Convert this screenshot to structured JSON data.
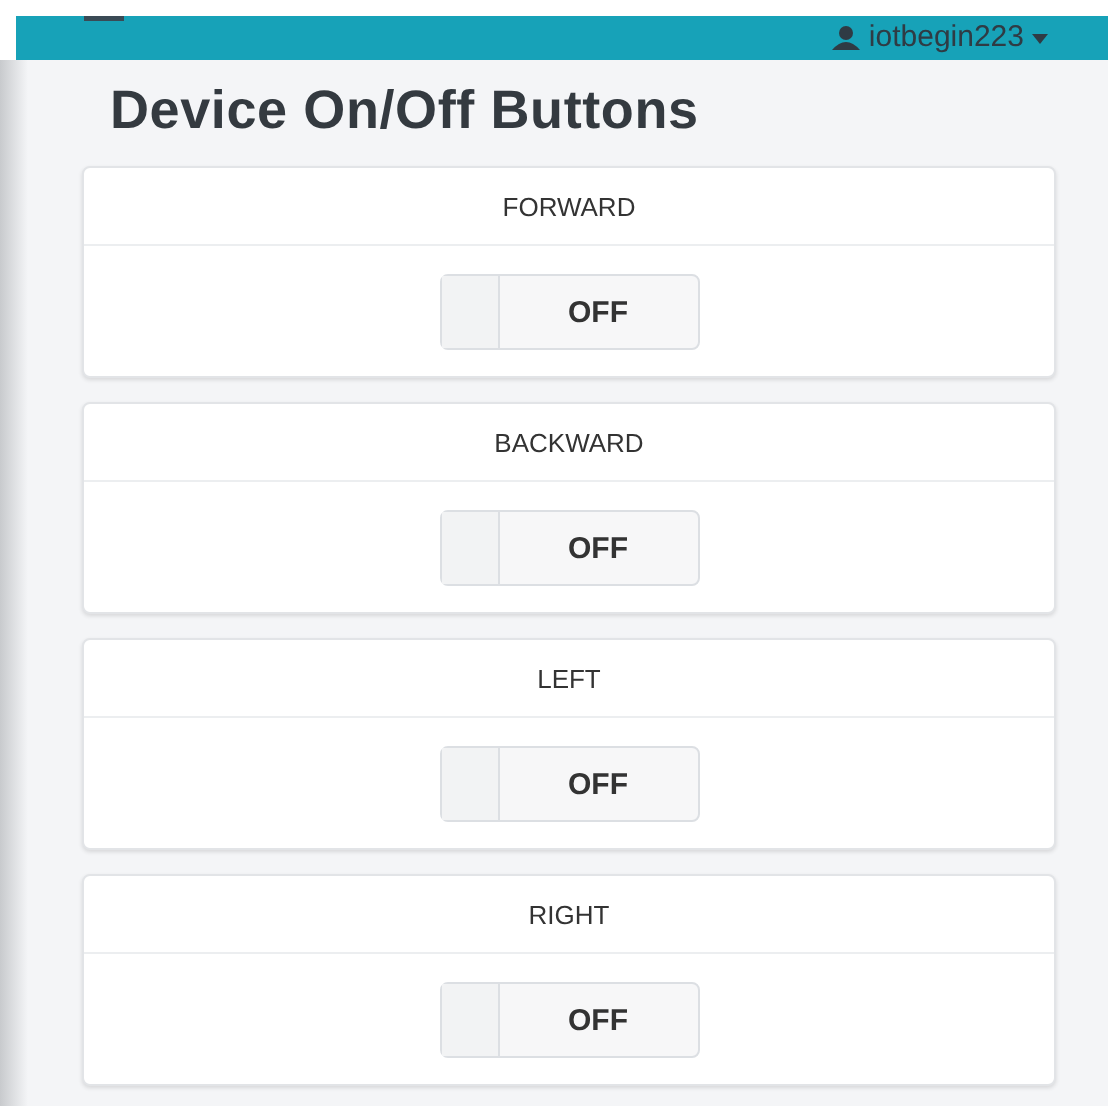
{
  "header": {
    "username": "iotbegin223"
  },
  "title": "Device On/Off Buttons",
  "devices": [
    {
      "name": "FORWARD",
      "state_label": "OFF",
      "on": false
    },
    {
      "name": "BACKWARD",
      "state_label": "OFF",
      "on": false
    },
    {
      "name": "LEFT",
      "state_label": "OFF",
      "on": false
    },
    {
      "name": "RIGHT",
      "state_label": "OFF",
      "on": false
    }
  ]
}
